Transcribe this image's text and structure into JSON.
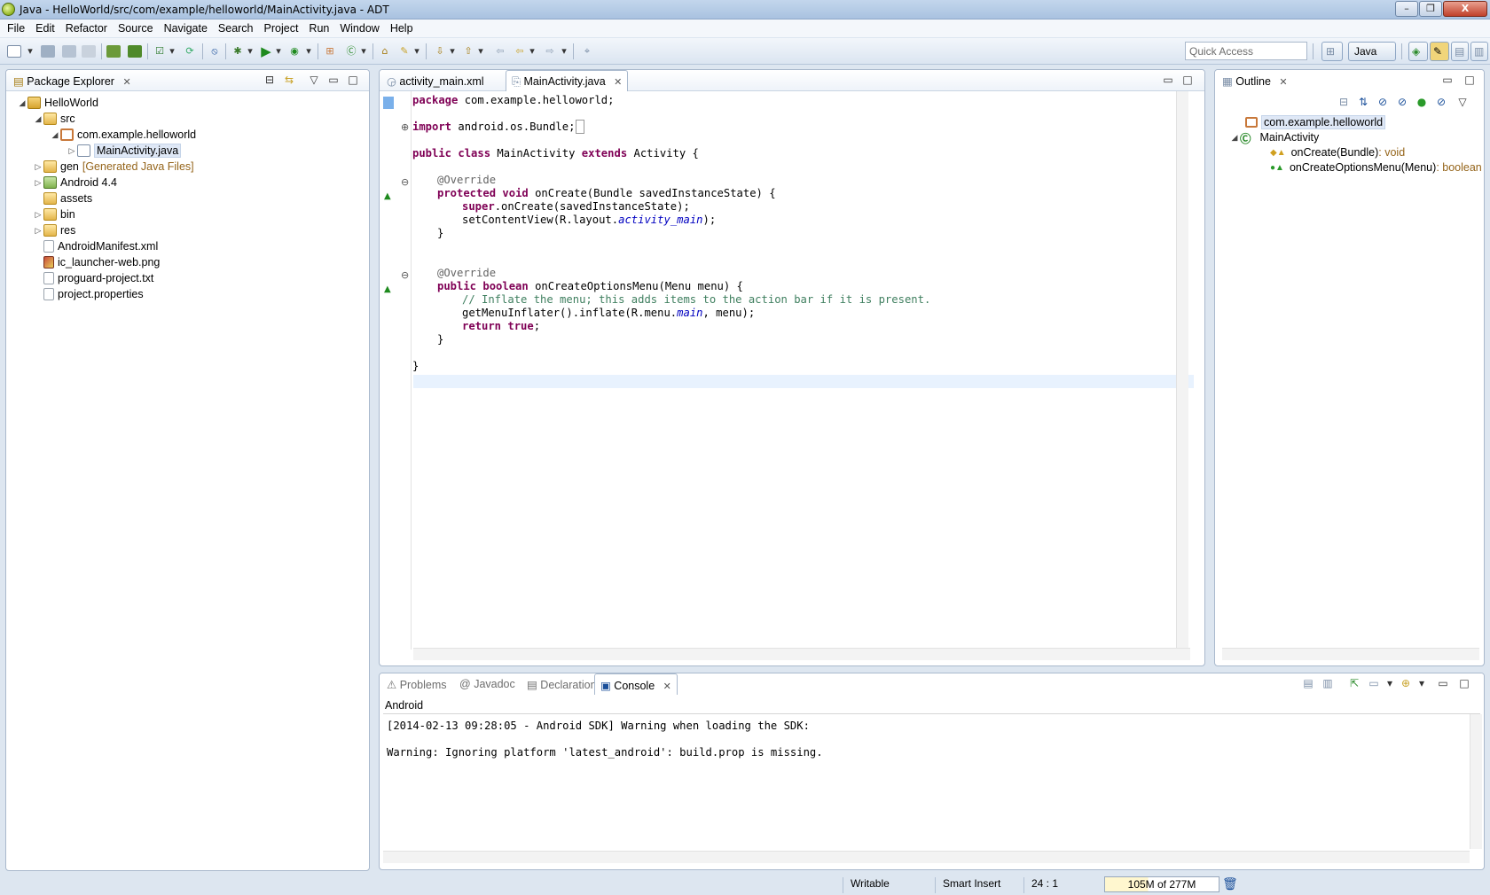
{
  "window": {
    "title": "Java - HelloWorld/src/com/example/helloworld/MainActivity.java - ADT",
    "controls": {
      "minimize": "–",
      "restore": "❐",
      "close": "X"
    }
  },
  "menu": [
    "File",
    "Edit",
    "Refactor",
    "Source",
    "Navigate",
    "Search",
    "Project",
    "Run",
    "Window",
    "Help"
  ],
  "toolbar": {
    "quick_access_placeholder": "Quick Access",
    "perspective": "Java"
  },
  "package_explorer": {
    "title": "Package Explorer",
    "tree": [
      {
        "label": "HelloWorld",
        "expander": "◢",
        "icon": "project-icon"
      },
      {
        "label": "src",
        "expander": "◢",
        "icon": "source-folder-icon"
      },
      {
        "label": "com.example.helloworld",
        "expander": "◢",
        "icon": "package-icon"
      },
      {
        "label": "MainActivity.java",
        "expander": "▷",
        "icon": "java-file-icon"
      },
      {
        "label": "gen",
        "decoration": "[Generated Java Files]",
        "expander": "▷",
        "icon": "source-folder-icon"
      },
      {
        "label": "Android 4.4",
        "expander": "▷",
        "icon": "library-icon"
      },
      {
        "label": "assets",
        "expander": "",
        "icon": "folder-icon"
      },
      {
        "label": "bin",
        "expander": "▷",
        "icon": "folder-icon"
      },
      {
        "label": "res",
        "expander": "▷",
        "icon": "folder-icon"
      },
      {
        "label": "AndroidManifest.xml",
        "expander": "",
        "icon": "xml-file-icon"
      },
      {
        "label": "ic_launcher-web.png",
        "expander": "",
        "icon": "image-file-icon"
      },
      {
        "label": "proguard-project.txt",
        "expander": "",
        "icon": "text-file-icon"
      },
      {
        "label": "project.properties",
        "expander": "",
        "icon": "text-file-icon"
      }
    ]
  },
  "editor": {
    "tabs": [
      {
        "label": "activity_main.xml",
        "active": false
      },
      {
        "label": "MainActivity.java",
        "active": true
      }
    ],
    "code": {
      "l1_kw": "package",
      "l1_rest": " com.example.helloworld;",
      "l2_kw": "import",
      "l2_rest": " android.os.Bundle;",
      "l3_kw1": "public",
      "l3_kw2": "class",
      "l3_name": " MainActivity ",
      "l3_kw3": "extends",
      "l3_rest": " Activity {",
      "l4_ann": "@Override",
      "l5_kw1": "protected",
      "l5_kw2": "void",
      "l5_rest": " onCreate(Bundle savedInstanceState) {",
      "l6_kw": "super",
      "l6_rest": ".onCreate(savedInstanceState);",
      "l7_a": "setContentView(R.layout.",
      "l7_it": "activity_main",
      "l7_b": ");",
      "l8": "}",
      "l9_ann": "@Override",
      "l10_kw1": "public",
      "l10_kw2": "boolean",
      "l10_rest": " onCreateOptionsMenu(Menu menu) {",
      "l11_cmt": "// Inflate the menu; this adds items to the action bar if it is present.",
      "l12_a": "getMenuInflater().inflate(R.menu.",
      "l12_it": "main",
      "l12_b": ", menu);",
      "l13_kw1": "return",
      "l13_kw2": "true",
      "l13_b": ";",
      "l14": "}",
      "l15": "}"
    }
  },
  "outline": {
    "title": "Outline",
    "items": [
      {
        "label": "com.example.helloworld",
        "type": ""
      },
      {
        "label": "MainActivity",
        "type": ""
      },
      {
        "label": "onCreate(Bundle)",
        "type": " : void"
      },
      {
        "label": "onCreateOptionsMenu(Menu)",
        "type": " : boolean"
      }
    ]
  },
  "bottom": {
    "tabs": [
      "Problems",
      "Javadoc",
      "Declaration",
      "Console"
    ],
    "active_tab": "Console",
    "console_name": "Android",
    "lines": [
      "[2014-02-13 09:28:05 - Android SDK] Warning when loading the SDK:",
      "Warning: Ignoring platform 'latest_android': build.prop is missing."
    ]
  },
  "status": {
    "writable": "Writable",
    "insert_mode": "Smart Insert",
    "position": "24 : 1",
    "heap": "105M of 277M",
    "heap_used_fraction": 0.38
  }
}
